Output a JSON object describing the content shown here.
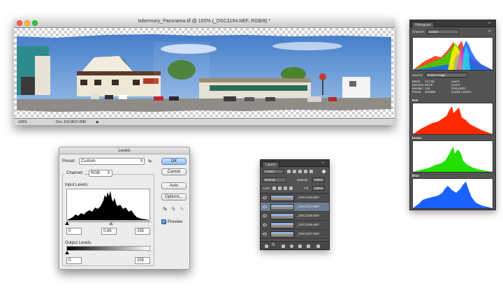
{
  "document": {
    "title": "tobermory_Panorama.tif @ 100% (_DSC3194.NEF, RGB/8) *",
    "status_zoom": "100%",
    "status_doc": "Doc: 910.8K/2.40M"
  },
  "histogram_panel": {
    "tab": "Histogram",
    "channel_label": "Channel:",
    "channel_value": "Colors",
    "source_label": "Source:",
    "source_value": "Entire Image",
    "stats_left_labels": [
      "Mean:",
      "Std Dev:",
      "Median:",
      "Pixels:"
    ],
    "stats_left_values": [
      "117.83",
      "59.55",
      "119",
      "315898"
    ],
    "stats_right_labels": [
      "Level:",
      "Count:",
      "Percentile:",
      "Cache Level:"
    ],
    "stats_right_values": [
      "",
      "",
      "",
      "1"
    ],
    "red_label": "Red",
    "green_label": "Green",
    "blue_label": "Blue"
  },
  "levels": {
    "title": "Levels",
    "preset_label": "Preset:",
    "preset_value": "Custom",
    "channel_label": "Channel:",
    "channel_value": "RGB",
    "input_label": "Input Levels:",
    "input_black": "0",
    "input_gamma": "0.86",
    "input_white": "255",
    "output_label": "Output Levels:",
    "output_black": "0",
    "output_white": "255",
    "ok": "OK",
    "cancel": "Cancel",
    "auto": "Auto",
    "options": "Options...",
    "preview": "Preview"
  },
  "layers_panel": {
    "tab": "Layers",
    "kind": "Kind",
    "blend_mode": "Normal",
    "opacity_label": "Opacity:",
    "opacity_value": "100%",
    "lock_label": "Lock:",
    "fill_label": "Fill:",
    "fill_value": "100%",
    "layers": [
      "_DSC3193.NEF",
      "_DSC3194.NEF",
      "_DSC3195.NEF",
      "_DSC3196.NEF",
      "_DSC3197.NEF"
    ],
    "selected_index": 1
  },
  "colors": {
    "red": "#ff2a00",
    "green": "#22e000",
    "blue": "#1a62ff",
    "selection": "#6d7f95",
    "ok_button": "#8ebcf0"
  }
}
